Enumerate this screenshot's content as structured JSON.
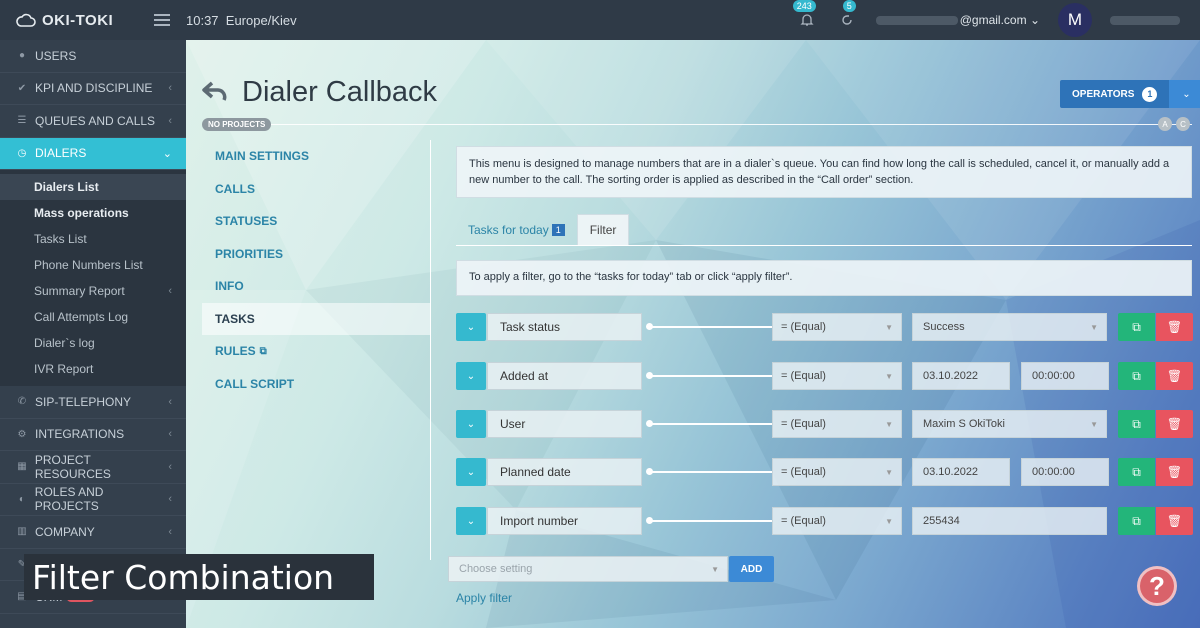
{
  "app": {
    "logo_text": "OKI-TOKI"
  },
  "topbar": {
    "time": "10:37",
    "timezone": "Europe/Kiev",
    "notifications_count": "243",
    "tasks_count": "5",
    "email_suffix": "@gmail.com",
    "avatar_initial": "M"
  },
  "sidebar": {
    "items": [
      {
        "label": "USERS",
        "icon": "user-icon"
      },
      {
        "label": "KPI AND DISCIPLINE",
        "icon": "check-icon"
      },
      {
        "label": "QUEUES AND CALLS",
        "icon": "list-icon"
      },
      {
        "label": "DIALERS",
        "icon": "clock-icon",
        "active": true
      }
    ],
    "dialers_sub": [
      {
        "label": "Dialers List"
      },
      {
        "label": "Mass operations"
      },
      {
        "label": "Tasks List"
      },
      {
        "label": "Phone Numbers List"
      },
      {
        "label": "Summary Report"
      },
      {
        "label": "Call Attempts Log"
      },
      {
        "label": "Dialer`s log"
      },
      {
        "label": "IVR Report"
      }
    ],
    "lower_items": [
      {
        "label": "SIP-TELEPHONY"
      },
      {
        "label": "INTEGRATIONS"
      },
      {
        "label": "PROJECT RESOURCES"
      },
      {
        "label": "ROLES AND PROJECTS"
      },
      {
        "label": "COMPANY"
      },
      {
        "label": ""
      },
      {
        "label": "CRM"
      }
    ],
    "crm_badge": "BETA"
  },
  "page": {
    "title": "Dialer Callback",
    "operators_label": "OPERATORS",
    "operators_count": "1",
    "no_projects": "NO PROJECTS",
    "badge_a": "A",
    "badge_c": "C"
  },
  "section_nav": [
    {
      "label": "MAIN SETTINGS"
    },
    {
      "label": "CALLS"
    },
    {
      "label": "STATUSES"
    },
    {
      "label": "PRIORITIES"
    },
    {
      "label": "INFO"
    },
    {
      "label": "TASKS"
    },
    {
      "label": "RULES"
    },
    {
      "label": "CALL SCRIPT"
    }
  ],
  "info_text": "This menu is designed to manage numbers that are in a dialer`s queue. You can find how long the call is scheduled, cancel it, or manually add a new number to the call. The sorting order is applied as described in the “Call order” section.",
  "tabs": [
    {
      "label": "Tasks for today",
      "count": "1"
    },
    {
      "label": "Filter"
    }
  ],
  "filter_hint": "To apply a filter, go to the “tasks for today” tab or click “apply filter”.",
  "filters": [
    {
      "field": "Task status",
      "condition": "= (Equal)",
      "value": "Success"
    },
    {
      "field": "Added at",
      "condition": "= (Equal)",
      "value": "03.10.2022",
      "time": "00:00:00"
    },
    {
      "field": "User",
      "condition": "= (Equal)",
      "value": "Maxim S OkiToki"
    },
    {
      "field": "Planned date",
      "condition": "= (Equal)",
      "value": "03.10.2022",
      "time": "00:00:00"
    },
    {
      "field": "Import number",
      "condition": "= (Equal)",
      "value": "255434"
    }
  ],
  "choose_setting_placeholder": "Choose setting",
  "add_label": "ADD",
  "apply_filter_label": "Apply filter",
  "help_label": "?",
  "caption": "Filter Combination",
  "colors": {
    "accent": "#35b9cf",
    "primary": "#2e73b8",
    "copy": "#23b57a",
    "delete": "#e8545f"
  }
}
